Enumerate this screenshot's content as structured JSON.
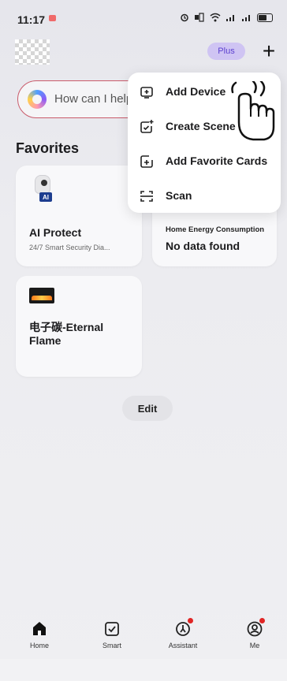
{
  "status_bar": {
    "time": "11:17",
    "icons": [
      "alarm-icon",
      "signal-icon",
      "wifi-icon",
      "cell-signal-icon",
      "battery-icon"
    ]
  },
  "header": {
    "plus_label": "Plus",
    "add_symbol": "+"
  },
  "search": {
    "placeholder": "How can I help you?"
  },
  "favorites": {
    "title": "Favorites",
    "cards": [
      {
        "name": "AI Protect",
        "subtitle": "24/7 Smart Security Dia...",
        "icon": "camera-ai-icon"
      },
      {
        "title": "Home Energy Consumption",
        "value": "No data found"
      },
      {
        "name": "电子碳-Eternal Flame",
        "icon": "fireplace-icon"
      }
    ]
  },
  "edit_label": "Edit",
  "popup_menu": {
    "items": [
      {
        "label": "Add Device",
        "icon": "add-device-icon"
      },
      {
        "label": "Create Scene",
        "icon": "create-scene-icon"
      },
      {
        "label": "Add Favorite Cards",
        "icon": "add-card-icon"
      },
      {
        "label": "Scan",
        "icon": "scan-icon"
      }
    ]
  },
  "bottom_nav": {
    "items": [
      {
        "label": "Home",
        "icon": "home-icon",
        "active": true
      },
      {
        "label": "Smart",
        "icon": "smart-icon",
        "active": false
      },
      {
        "label": "Assistant",
        "icon": "assistant-icon",
        "active": false,
        "badge": true
      },
      {
        "label": "Me",
        "icon": "me-icon",
        "active": false,
        "badge": true
      }
    ]
  },
  "colors": {
    "accent_purple": "#5b3fcf",
    "plus_bg": "#cfc4f3",
    "search_border": "#c95a6a",
    "badge_red": "#e02525"
  }
}
